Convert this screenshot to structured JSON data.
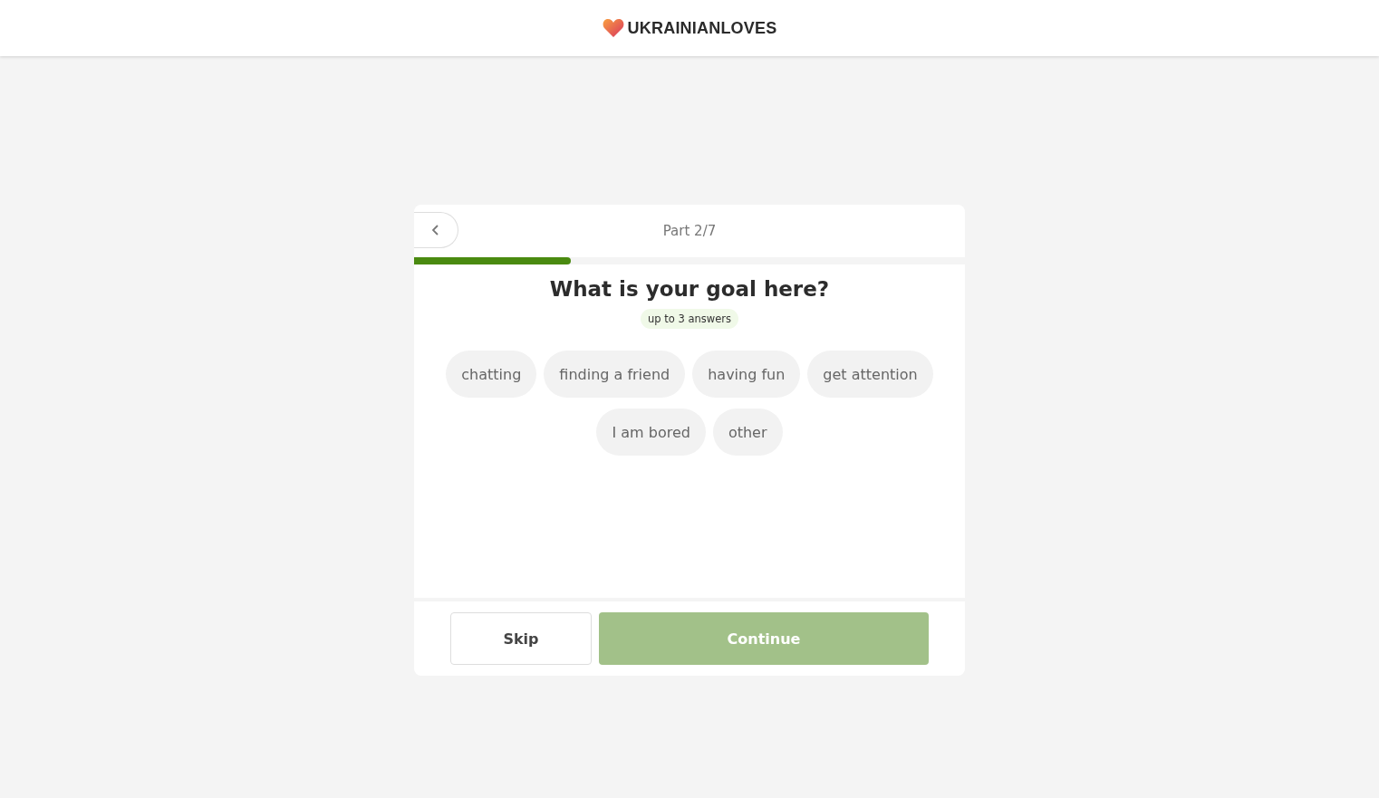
{
  "header": {
    "logo": "UKRAINIANLOVES"
  },
  "quiz": {
    "part": "Part 2/7",
    "progress": {
      "level": 0.285
    },
    "question": "What is your goal here?",
    "hint": "up to 3 answers",
    "options": [
      {
        "label": "chatting",
        "selected": false
      },
      {
        "label": "finding a friend",
        "selected": false
      },
      {
        "label": "having fun",
        "selected": false
      },
      {
        "label": "get attention",
        "selected": false
      },
      {
        "label": "I am bored",
        "selected": false
      },
      {
        "label": "other",
        "selected": false
      }
    ],
    "buttons": {
      "skip": "Skip",
      "continue": {
        "label": "Continue",
        "disabled": true
      }
    }
  }
}
